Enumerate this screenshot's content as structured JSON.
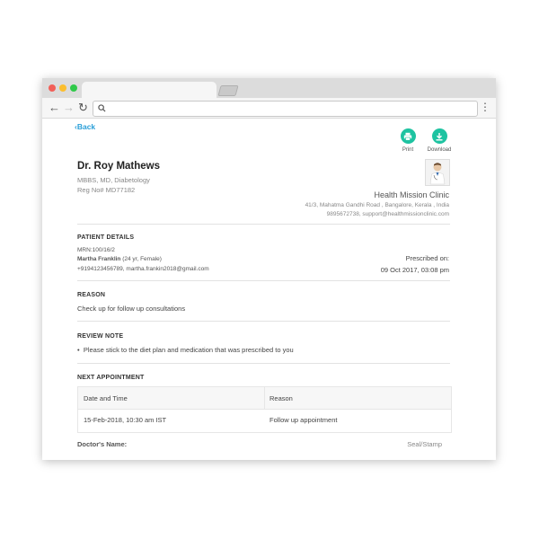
{
  "nav": {
    "back_label": "Back"
  },
  "actions": {
    "print_label": "Print",
    "download_label": "Download"
  },
  "doctor": {
    "name": "Dr. Roy Mathews",
    "qualification": "MBBS, MD, Diabetology",
    "reg_no": "Reg No# MD77182"
  },
  "clinic": {
    "name": "Health Mission Clinic",
    "address": "41/3, Mahatma Gandhi Road , Bangalore, Kerala , India",
    "contact": "9895672738, support@healthmissionclinic.com"
  },
  "patient": {
    "section_title": "PATIENT DETAILS",
    "mrn": "MRN:100/16/2",
    "name": "Martha Franklin",
    "age_gender": "(24 yr, Female)",
    "contact": "+9194123456789, martha.frankin2018@gmail.com",
    "prescribed_label": "Prescribed on:",
    "prescribed_date": "09 Oct 2017, 03:08 pm"
  },
  "reason": {
    "section_title": "REASON",
    "text": "Check up for follow up consultations"
  },
  "review": {
    "section_title": "REVIEW NOTE",
    "bullet": "•",
    "note": "Please stick to the diet plan and medication that was prescribed to you"
  },
  "appointment": {
    "section_title": "NEXT APPOINTMENT",
    "headers": [
      "Date and Time",
      "Reason"
    ],
    "rows": [
      [
        "15-Feb-2018, 10:30 am IST",
        "Follow up appointment"
      ]
    ]
  },
  "footer": {
    "doctor_label": "Doctor's Name:",
    "seal_label": "Seal/Stamp"
  },
  "colors": {
    "accent": "#1ec3a1",
    "link": "#2a9fd8"
  }
}
